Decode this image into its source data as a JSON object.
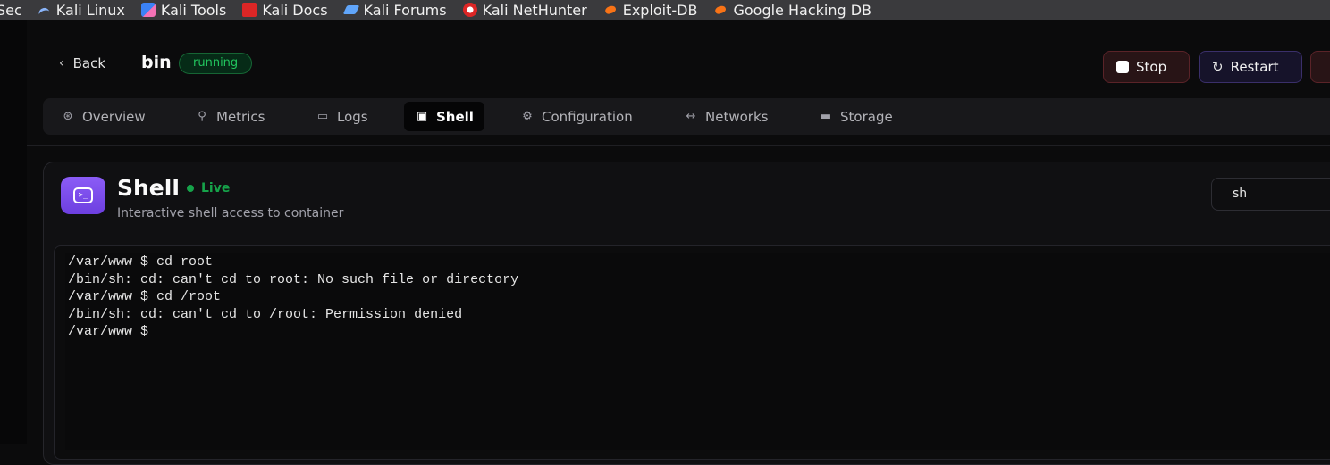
{
  "bookmarks": [
    {
      "label": "Sec",
      "icon": "none"
    },
    {
      "label": "Kali Linux",
      "icon": "kali-dragon-icon"
    },
    {
      "label": "Kali Tools",
      "icon": "kali-tools-icon"
    },
    {
      "label": "Kali Docs",
      "icon": "kali-docs-icon"
    },
    {
      "label": "Kali Forums",
      "icon": "kali-forums-icon"
    },
    {
      "label": "Kali NetHunter",
      "icon": "nethunter-icon"
    },
    {
      "label": "Exploit-DB",
      "icon": "exploit-db-icon"
    },
    {
      "label": "Google Hacking DB",
      "icon": "exploit-db-icon"
    }
  ],
  "header": {
    "back_label": "Back",
    "container_name": "bin",
    "status": "running",
    "actions": {
      "stop": "Stop",
      "restart": "Restart"
    }
  },
  "tabs": [
    {
      "label": "Overview",
      "icon": "overview-icon"
    },
    {
      "label": "Metrics",
      "icon": "metrics-icon"
    },
    {
      "label": "Logs",
      "icon": "logs-icon"
    },
    {
      "label": "Shell",
      "icon": "shell-icon",
      "active": true
    },
    {
      "label": "Configuration",
      "icon": "gear-icon"
    },
    {
      "label": "Networks",
      "icon": "network-icon"
    },
    {
      "label": "Storage",
      "icon": "storage-icon"
    }
  ],
  "shell": {
    "title": "Shell",
    "live_label": "Live",
    "subtitle": "Interactive shell access to container",
    "selected_shell": "sh",
    "lines": [
      "/var/www $ cd root",
      "/bin/sh: cd: can't cd to root: No such file or directory",
      "/var/www $ cd /root",
      "/bin/sh: cd: can't cd to /root: Permission denied",
      "/var/www $"
    ]
  },
  "colors": {
    "accent_purple": "#7c4dee",
    "status_green": "#22c55e",
    "stop_red": "#5a2328"
  }
}
